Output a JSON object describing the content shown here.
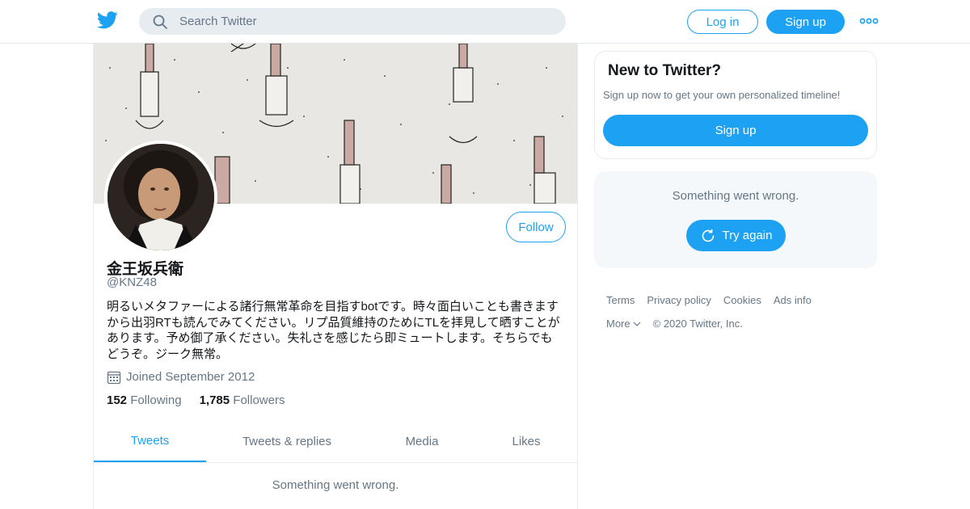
{
  "header": {
    "search_placeholder": "Search Twitter",
    "login_label": "Log in",
    "signup_label": "Sign up"
  },
  "profile": {
    "display_name": "金王坂兵衛",
    "handle": "@KNZ48",
    "follow_label": "Follow",
    "bio_lines": [
      "明るいメタファーによる諸行無常革命を目指すbotです。時々面白いことも書きます",
      "から出羽RTも読んでみてください。リプ品質維持のためにTLを拝見して晒すことが",
      "あります。予め御了承ください。失礼さを感じたら即ミュートします。そちらでも",
      "どうぞ。ジーク無常。"
    ],
    "joined": "Joined September 2012",
    "following_count": "152",
    "following_label": "Following",
    "followers_count": "1,785",
    "followers_label": "Followers"
  },
  "tabs": [
    {
      "label": "Tweets",
      "active": true
    },
    {
      "label": "Tweets & replies",
      "active": false
    },
    {
      "label": "Media",
      "active": false
    },
    {
      "label": "Likes",
      "active": false
    }
  ],
  "timeline": {
    "error_text": "Something went wrong."
  },
  "sidebar": {
    "new_title": "New to Twitter?",
    "new_subtitle": "Sign up now to get your own personalized timeline!",
    "new_signup_label": "Sign up",
    "error_text": "Something went wrong.",
    "retry_label": "Try again"
  },
  "footer": {
    "links": [
      "Terms",
      "Privacy policy",
      "Cookies",
      "Ads info"
    ],
    "more_label": "More",
    "copyright": "© 2020 Twitter, Inc."
  },
  "colors": {
    "accent": "#1da1f2",
    "muted_text": "#657786",
    "border": "#e6ecf0"
  }
}
